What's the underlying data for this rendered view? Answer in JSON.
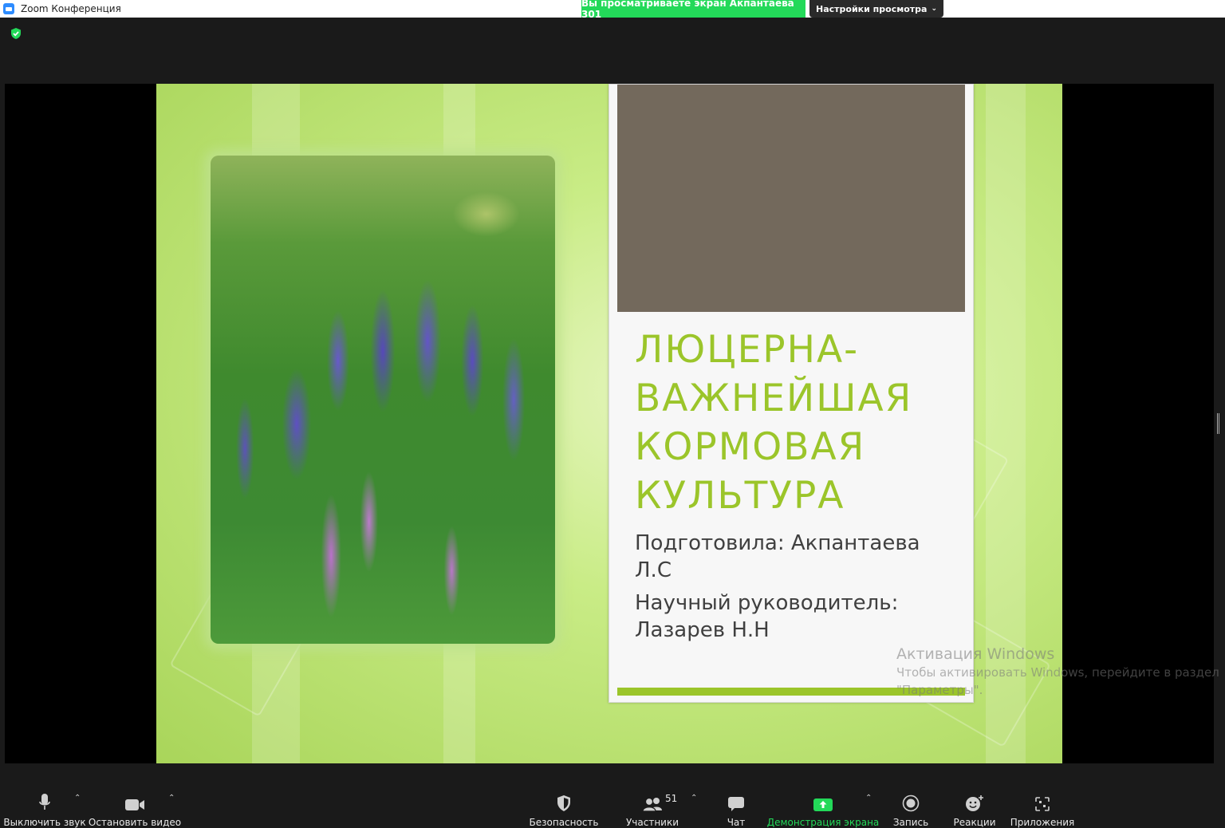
{
  "window": {
    "title": "Zoom Конференция"
  },
  "share_banner": {
    "text": "Вы просматриваете экран Акпантаева 301"
  },
  "view_options": {
    "label": "Настройки просмотра",
    "chevron": "chevron-down-icon"
  },
  "security_badge": {
    "icon": "shield-check-icon",
    "color": "#23d959"
  },
  "slide": {
    "title_lines": [
      "ЛЮЦЕРНА-",
      "ВАЖНЕЙШАЯ",
      "КОРМОВАЯ",
      "КУЛЬТУРА"
    ],
    "author": "Подготовила: Акпантаева Л.С",
    "supervisor": "Научный руководитель: Лазарев Н.Н",
    "accent_color": "#9bc52a",
    "image": "lavender-field-photo"
  },
  "windows_watermark": {
    "title": "Активация Windows",
    "text": "Чтобы активировать Windows, перейдите в раздел \"Параметры\"."
  },
  "toolbar": {
    "mute": {
      "label": "Выключить звук",
      "icon": "microphone-icon"
    },
    "video": {
      "label": "Остановить видео",
      "icon": "video-camera-icon"
    },
    "security": {
      "label": "Безопасность",
      "icon": "shield-icon"
    },
    "participants": {
      "label": "Участники",
      "icon": "participants-icon",
      "count": "51"
    },
    "chat": {
      "label": "Чат",
      "icon": "chat-bubble-icon"
    },
    "share": {
      "label": "Демонстрация экрана",
      "icon": "share-screen-icon",
      "color": "#23d959"
    },
    "record": {
      "label": "Запись",
      "icon": "record-icon"
    },
    "reactions": {
      "label": "Реакции",
      "icon": "emoji-plus-icon"
    },
    "apps": {
      "label": "Приложения",
      "icon": "apps-icon"
    }
  }
}
